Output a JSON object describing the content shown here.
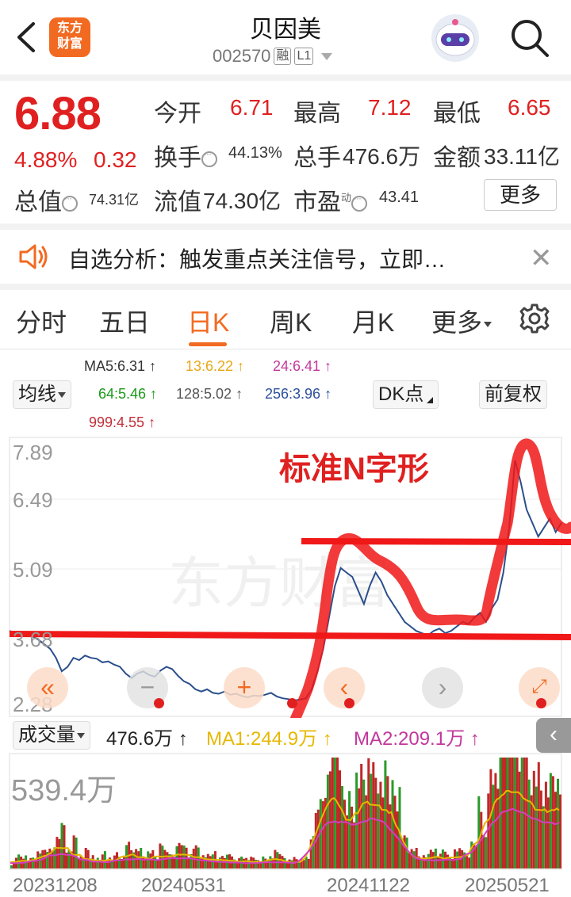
{
  "header": {
    "title": "贝因美",
    "code": "002570",
    "tag_margin": "融",
    "tag_level": "L1",
    "logo_line1": "东方",
    "logo_line2": "财富"
  },
  "quote": {
    "price": "6.88",
    "change_pct": "4.88%",
    "change_abs": "0.32",
    "open_label": "今开",
    "open": "6.71",
    "high_label": "最高",
    "high": "7.12",
    "low_label": "最低",
    "low": "6.65",
    "turnover_label": "换手",
    "turnover": "44.13%",
    "volume_label": "总手",
    "volume": "476.6万",
    "amount_label": "金额",
    "amount": "33.11亿",
    "mktcap_label": "总值",
    "mktcap": "74.31亿",
    "float_label": "流值",
    "float": "74.30亿",
    "pe_label": "市盈",
    "pe_sup": "动",
    "pe": "43.41",
    "more_label": "更多"
  },
  "notice": {
    "text": "自选分析：触发重点关注信号，立即…"
  },
  "tabs": [
    {
      "label": "分时"
    },
    {
      "label": "五日"
    },
    {
      "label": "日K"
    },
    {
      "label": "周K"
    },
    {
      "label": "月K"
    },
    {
      "label": "更多"
    }
  ],
  "ma_legend": {
    "selector": "均线",
    "ma5": "MA5:6.31 ↑",
    "ma13": "13:6.22 ↑",
    "ma24": "24:6.41 ↑",
    "ma64": "64:5.46 ↑",
    "ma128": "128:5.02 ↑",
    "ma256": "256:3.96 ↑",
    "ma999": "999:4.55 ↑",
    "dk_label": "DK点",
    "adjust_label": "前复权"
  },
  "colors": {
    "ma5": "#333333",
    "ma13": "#e6a817",
    "ma24": "#c2379d",
    "ma64": "#1a9a1a",
    "ma128": "#555555",
    "ma256": "#2b4f9c",
    "ma999": "#c0303a",
    "accent": "#f26a21",
    "up_red": "#e02020"
  },
  "chart": {
    "y_labels": [
      "7.89",
      "6.49",
      "5.09",
      "3.68",
      "2.28"
    ],
    "watermark": "东方财富",
    "annotation": "标准N字形"
  },
  "volume": {
    "selector": "成交量",
    "value": "476.6万 ↑",
    "ma1": "MA1:244.9万 ↑",
    "ma2": "MA2:209.1万 ↑",
    "max_label": "539.4万"
  },
  "dates": [
    "20231208",
    "20240531",
    "20241122",
    "20250521"
  ],
  "chart_data": {
    "type": "line",
    "title": "",
    "ylim": [
      2.28,
      7.89
    ],
    "x_labels": [
      "20231208",
      "20240531",
      "20241122",
      "20250521"
    ],
    "series": [
      {
        "values": [
          3.9,
          3.85,
          3.8,
          3.82,
          3.78,
          3.7,
          3.6,
          3.5,
          3.3,
          3.0,
          3.1,
          3.3,
          3.25,
          3.35,
          3.3,
          3.28,
          3.2,
          3.22,
          3.15,
          3.1,
          2.95,
          2.85,
          2.95,
          3.0,
          2.92,
          2.88,
          3.02,
          3.1,
          3.05,
          2.9,
          2.78,
          2.72,
          2.6,
          2.55,
          2.6,
          2.52,
          2.5,
          2.55,
          2.48,
          2.5,
          2.45,
          2.42,
          2.46,
          2.45,
          2.48,
          2.52,
          2.44,
          2.4,
          2.38,
          2.35,
          2.37,
          2.4,
          2.6,
          3.0,
          3.5,
          4.2,
          4.9,
          5.3,
          5.2,
          5.1,
          4.8,
          4.5,
          4.9,
          5.2,
          5.0,
          4.7,
          4.5,
          4.3,
          4.1,
          4.0,
          3.9,
          3.85,
          3.8,
          3.9,
          3.95,
          3.85,
          3.9,
          4.0,
          4.1,
          4.05,
          4.2,
          4.3,
          4.1,
          4.4,
          4.6,
          5.2,
          6.2,
          7.7,
          7.2,
          6.6,
          6.3,
          6.0,
          6.2,
          6.4,
          6.1,
          6.31
        ]
      }
    ]
  }
}
